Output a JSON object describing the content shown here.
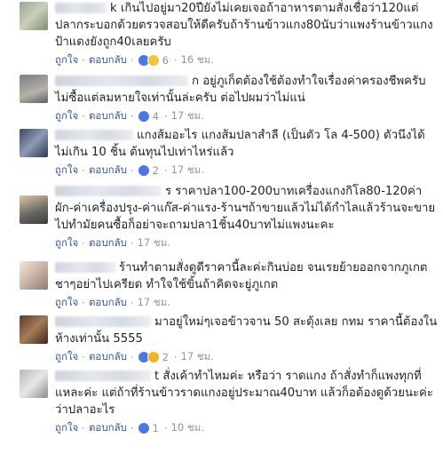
{
  "labels": {
    "like": "ถูกใจ",
    "reply": "ตอบกลับ",
    "dot": "·"
  },
  "comments": [
    {
      "name_fragment": "k",
      "text": "เกินไปอยู่มา20ปียังไม่เคยเจอถ้าอาหารตามสั่งเชื่อว่า120แต่ปลากระบอกด้วยตรวจสอบให้ดีครับถ้าร้านข้าวแกง80นับว่าแพงร้านข้าวแกงป้าแดงยังถูก40เลยครับ",
      "reactions": [
        "like-icon",
        "sad-icon"
      ],
      "count": "6",
      "time": "16 ชม."
    },
    {
      "name_fragment": "ก",
      "text": "อยู่ภูเก็ตต้องใช้ต้องทำใจเรื่องค่าครองชีพครับ ไม่ซื้อแต่ลมหายใจเท่านั้นล่ะครับ ต่อไปผมว่าไม่แน่",
      "reactions": [
        "like-icon"
      ],
      "count": "4",
      "time": "17 ชม."
    },
    {
      "name_fragment": "",
      "text": "แกงส้มอะไร แกงส้มปลาสำลี (เป็นตัว โล 4-500) ตัวนึงได้ไม่เกิน 10 ชิ้น ต้นทุนไปเท่าไหร่แล้ว",
      "reactions": [
        "like-icon"
      ],
      "count": "2",
      "time": "17 ชม."
    },
    {
      "name_fragment": "ร",
      "text": "ราคาปลา100-200บาทเครื่องแกงกิโล80-120ค่าผัก-ค่าเครื่องปรุง-ค่าแก๊ส-ค่าแรง-ร้านฯถ้าขายแล้วไม่ได้กำไลแล้วร้านจะขายไปทำมัยคนซื้อก็อย่าจะถามปลา1ชิ้น40บาทไม่แพงนะคะ",
      "reactions": [],
      "count": "",
      "time": "17 ชม."
    },
    {
      "name_fragment": "",
      "text": "ร้านทำตามสั่งดูดีราคานี้ละค่ะกินบ่อย จนเรยย้ายออกจากภูเกต ชาๆอย่าไปเครียด ทำใจใช้ขิ้นถ้าคิดจะยู่ภูเกต",
      "reactions": [],
      "count": "",
      "time": "17 ชม."
    },
    {
      "name_fragment": "",
      "text": "มาอยู่ใหม่ๆเจอข้าวจาน 50 สะดุ้งเลย กทม ราคานี้ต้องในห้างเท่านั้น 5555",
      "reactions": [
        "like-icon",
        "haha-icon"
      ],
      "count": "2",
      "time": "17 ชม."
    },
    {
      "name_fragment": "t",
      "text": "สั่งเค้าทำไหมค่ะ หรือว่า ราดแกง ถ้าสั่งทำก็แพงทุกที่แหละค่ะ แต่ถ้าที่ร้านข้าวราดแกงอยู่ประมาณ40บาท แล้วก็อต้องดูด้วยนะค่ะว่าปลาอะไร",
      "reactions": [
        "like-icon"
      ],
      "count": "1",
      "time": "10 ชม."
    }
  ]
}
